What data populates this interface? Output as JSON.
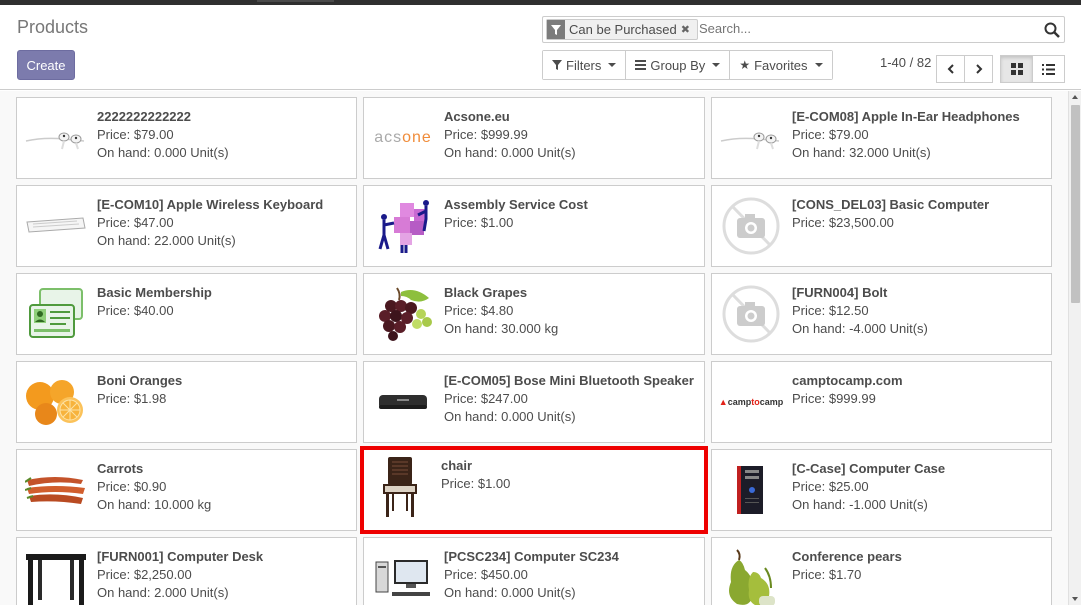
{
  "page": {
    "title": "Products"
  },
  "actions": {
    "create_label": "Create"
  },
  "search": {
    "facet_label": "Can be Purchased",
    "placeholder": "Search..."
  },
  "filters": {
    "filters_label": "Filters",
    "groupby_label": "Group By",
    "favorites_label": "Favorites"
  },
  "pager": {
    "value": "1-40 / 82"
  },
  "colors": {
    "primary": "#7c7bad",
    "highlight": "#e00000"
  },
  "products": [
    {
      "name": "2222222222222",
      "price": "Price: $79.00",
      "onhand": "On hand: 0.000 Unit(s)",
      "image": "earphones"
    },
    {
      "name": "Acsone.eu",
      "price": "Price: $999.99",
      "onhand": "On hand: 0.000 Unit(s)",
      "image": "acsone-logo",
      "logo_text": "acsone"
    },
    {
      "name": "[E-COM08] Apple In-Ear Headphones",
      "price": "Price: $79.00",
      "onhand": "On hand: 32.000 Unit(s)",
      "image": "earphones"
    },
    {
      "name": "[E-COM10] Apple Wireless Keyboard",
      "price": "Price: $47.00",
      "onhand": "On hand: 22.000 Unit(s)",
      "image": "keyboard"
    },
    {
      "name": "Assembly Service Cost",
      "price": "Price: $1.00",
      "onhand": "",
      "image": "puzzle"
    },
    {
      "name": "[CONS_DEL03] Basic Computer",
      "price": "Price: $23,500.00",
      "onhand": "",
      "image": "no-image"
    },
    {
      "name": "Basic Membership",
      "price": "Price: $40.00",
      "onhand": "",
      "image": "membership-cards"
    },
    {
      "name": "Black Grapes",
      "price": "Price: $4.80",
      "onhand": "On hand: 30.000 kg",
      "image": "grapes"
    },
    {
      "name": "[FURN004] Bolt",
      "price": "Price: $12.50",
      "onhand": "On hand: -4.000 Unit(s)",
      "image": "no-image"
    },
    {
      "name": "Boni Oranges",
      "price": "Price: $1.98",
      "onhand": "",
      "image": "oranges"
    },
    {
      "name": "[E-COM05] Bose Mini Bluetooth Speaker",
      "price": "Price: $247.00",
      "onhand": "On hand: 0.000 Unit(s)",
      "image": "speaker"
    },
    {
      "name": "camptocamp.com",
      "price": "Price: $999.99",
      "onhand": "",
      "image": "camptocamp-logo",
      "logo_text": "camptocamp"
    },
    {
      "name": "Carrots",
      "price": "Price: $0.90",
      "onhand": "On hand: 10.000 kg",
      "image": "carrots"
    },
    {
      "name": "chair",
      "price": "Price: $1.00",
      "onhand": "",
      "image": "chair",
      "highlighted": true
    },
    {
      "name": "[C-Case] Computer Case",
      "price": "Price: $25.00",
      "onhand": "On hand: -1.000 Unit(s)",
      "image": "computer-case"
    },
    {
      "name": "[FURN001] Computer Desk",
      "price": "Price: $2,250.00",
      "onhand": "On hand: 2.000 Unit(s)",
      "image": "desk"
    },
    {
      "name": "[PCSC234] Computer SC234",
      "price": "Price: $450.00",
      "onhand": "On hand: 0.000 Unit(s)",
      "image": "computer"
    },
    {
      "name": "Conference pears",
      "price": "Price: $1.70",
      "onhand": "",
      "image": "pears"
    }
  ]
}
